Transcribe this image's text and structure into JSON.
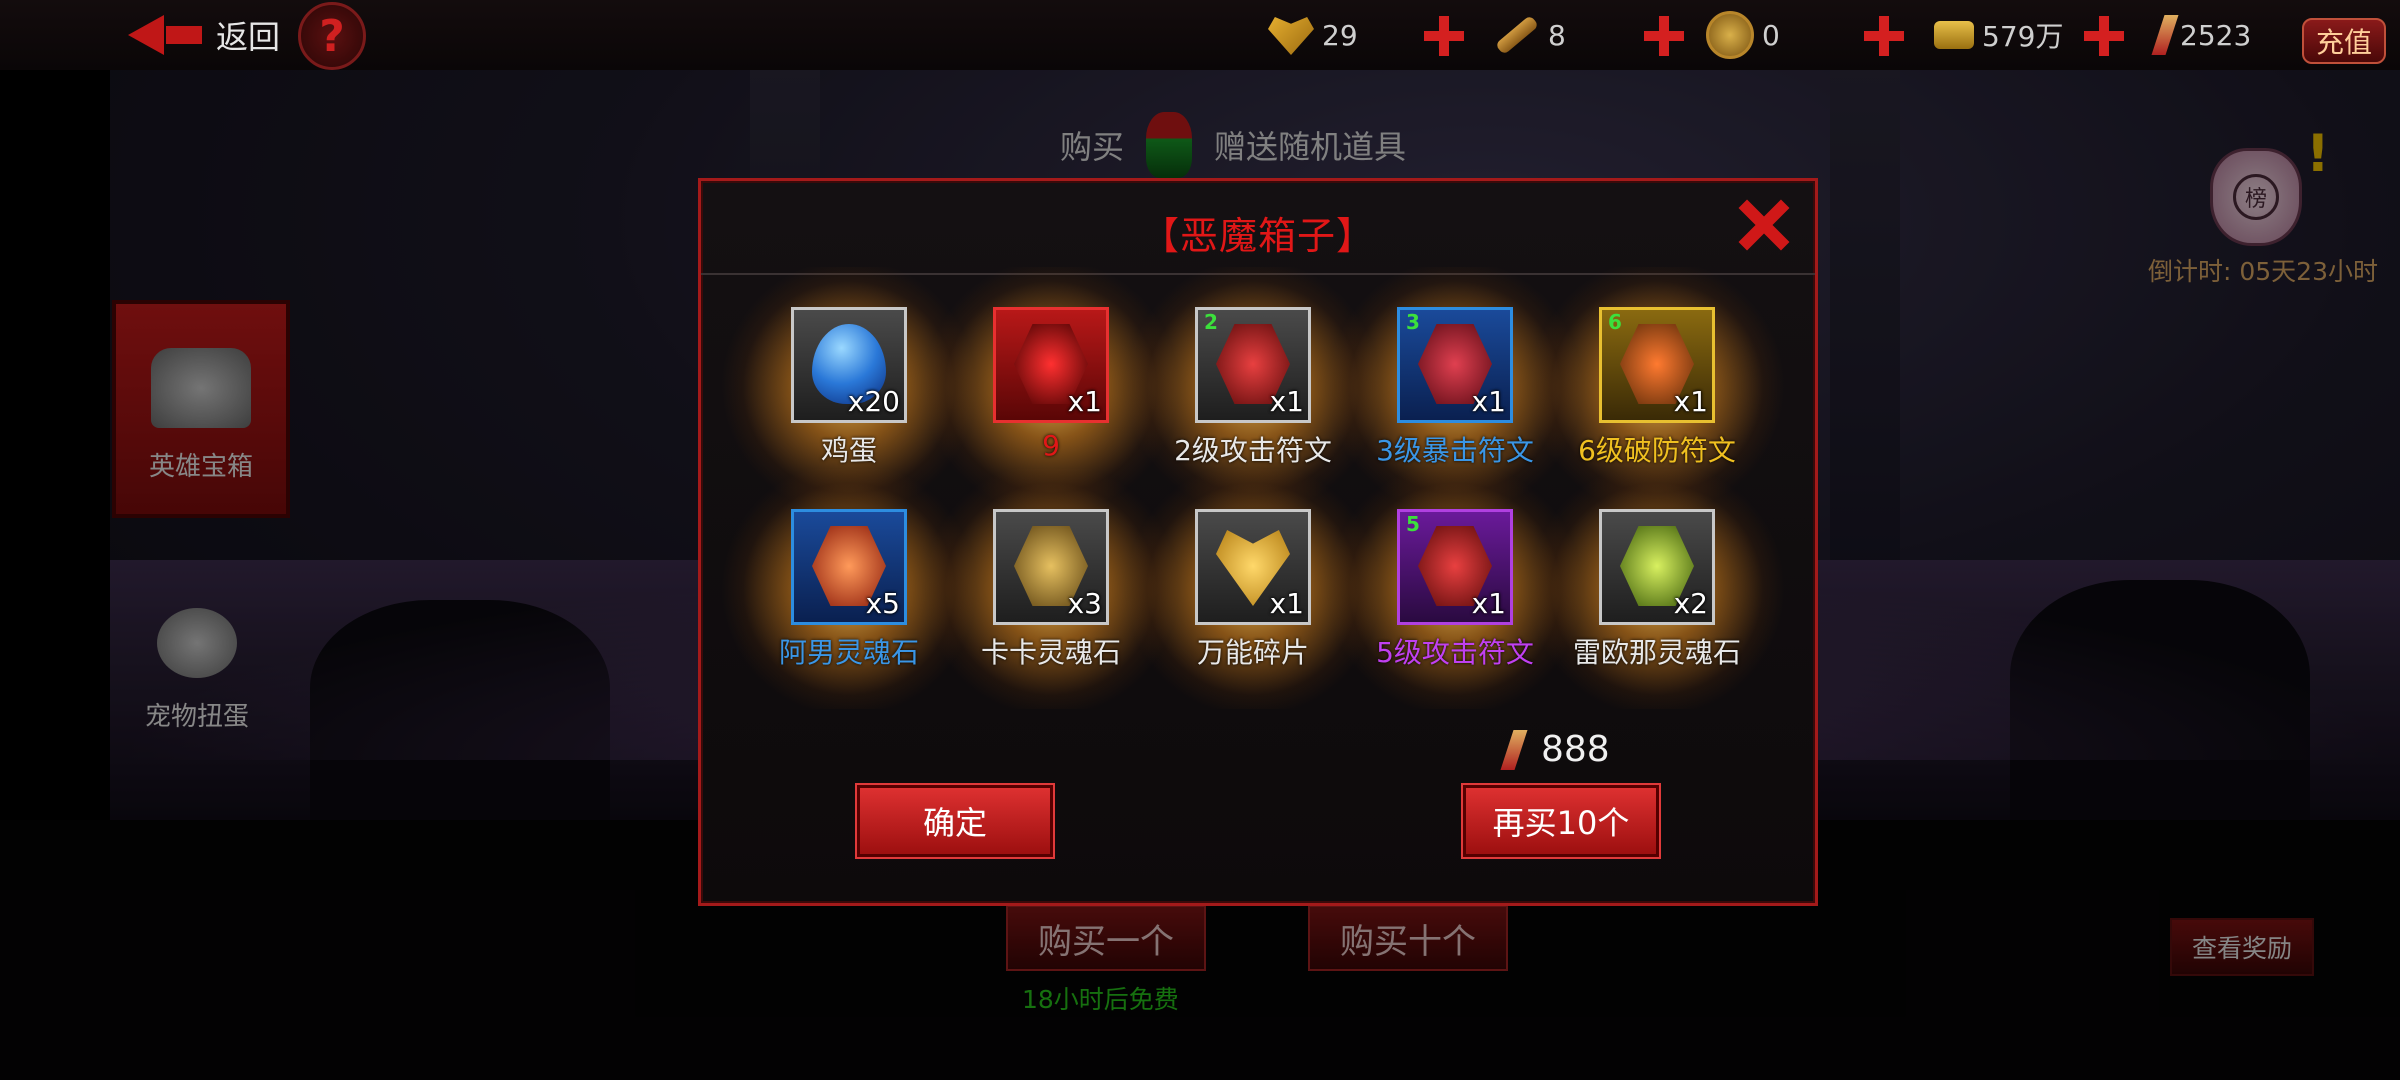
{
  "topbar": {
    "back_label": "返回",
    "help_symbol": "?",
    "resources": [
      {
        "icon": "stamina-heart-icon",
        "value": "29"
      },
      {
        "icon": "key-icon",
        "value": "8"
      },
      {
        "icon": "coin-icon",
        "value": "0"
      },
      {
        "icon": "gold-icon",
        "value": "579万"
      },
      {
        "icon": "gem-icon",
        "value": "2523"
      }
    ],
    "recharge_label": "充值"
  },
  "side_tabs": [
    {
      "label": "英雄宝箱",
      "active": true
    },
    {
      "label": "宠物扭蛋",
      "active": false
    }
  ],
  "right_panel": {
    "bag_glyph": "榜",
    "countdown": "倒计时: 05天23小时",
    "view_reward_label": "查看奖励"
  },
  "shop": {
    "buy_label": "购买",
    "gift_label": "赠送随机道具",
    "buy_one_label": "购买一个",
    "buy_ten_label": "购买十个",
    "free_note": "18小时后免费"
  },
  "dialog": {
    "title": "【恶魔箱子】",
    "items": [
      {
        "name": "鸡蛋",
        "qty": "x20",
        "level": "",
        "rarity": "white"
      },
      {
        "name": "9",
        "qty": "x1",
        "level": "",
        "rarity": "red"
      },
      {
        "name": "2级攻击符文",
        "qty": "x1",
        "level": "2",
        "rarity": "white"
      },
      {
        "name": "3级暴击符文",
        "qty": "x1",
        "level": "3",
        "rarity": "blue"
      },
      {
        "name": "6级破防符文",
        "qty": "x1",
        "level": "6",
        "rarity": "gold"
      },
      {
        "name": "阿男灵魂石",
        "qty": "x5",
        "level": "",
        "rarity": "blue"
      },
      {
        "name": "卡卡灵魂石",
        "qty": "x3",
        "level": "",
        "rarity": "white"
      },
      {
        "name": "万能碎片",
        "qty": "x1",
        "level": "",
        "rarity": "white"
      },
      {
        "name": "5级攻击符文",
        "qty": "x1",
        "level": "5",
        "rarity": "purple"
      },
      {
        "name": "雷欧那灵魂石",
        "qty": "x2",
        "level": "",
        "rarity": "white"
      }
    ],
    "price": "888",
    "confirm_label": "确定",
    "buy_again_label": "再买10个"
  },
  "colors": {
    "accent_red": "#e11717",
    "rarity_blue": "#3a96e6",
    "rarity_gold": "#f0c020",
    "rarity_purple": "#c040f0",
    "free_green": "#27c21a"
  }
}
